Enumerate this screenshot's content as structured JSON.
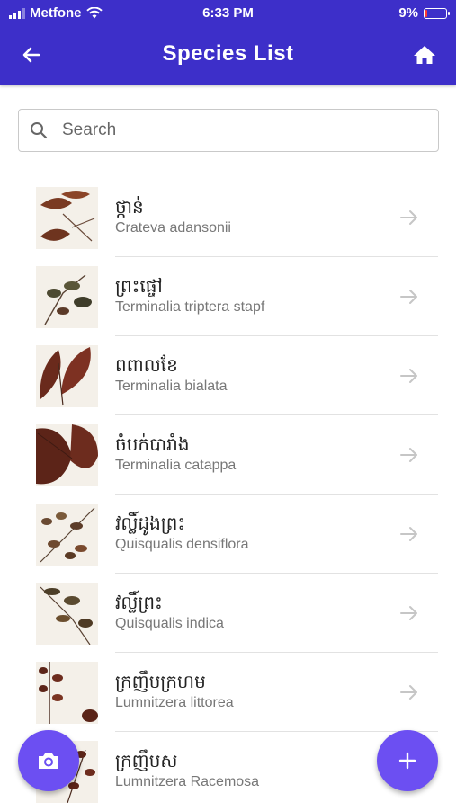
{
  "status": {
    "carrier": "Metfone",
    "time": "6:33 PM",
    "battery": "9%",
    "battery_level": 0.09,
    "battery_color": "#ff3b30"
  },
  "header": {
    "title": "Species List",
    "back_icon": "arrow-left-icon",
    "home_icon": "home-icon",
    "bg": "#3d2fc9"
  },
  "search": {
    "placeholder": "Search",
    "value": ""
  },
  "species": [
    {
      "local": "ថ្កាន់",
      "scientific": "Crateva adansonii"
    },
    {
      "local": "ព្រះផ្ចៅ",
      "scientific": "Terminalia triptera stapf"
    },
    {
      "local": "ពពាលខែ",
      "scientific": "Terminalia bialata"
    },
    {
      "local": "ចំបក់បារាំង",
      "scientific": "Terminalia catappa"
    },
    {
      "local": "វល្លិ៍ដូងព្រះ",
      "scientific": "Quisqualis densiflora"
    },
    {
      "local": "វល្លិ៍ព្រះ",
      "scientific": "Quisqualis indica"
    },
    {
      "local": "ក្រញឹបក្រហម",
      "scientific": "Lumnitzera littorea"
    },
    {
      "local": "ក្រញឹបស",
      "scientific": "Lumnitzera Racemosa"
    }
  ],
  "fabs": {
    "camera_icon": "camera-icon",
    "add_icon": "plus-icon",
    "color": "#6c4ff2"
  }
}
